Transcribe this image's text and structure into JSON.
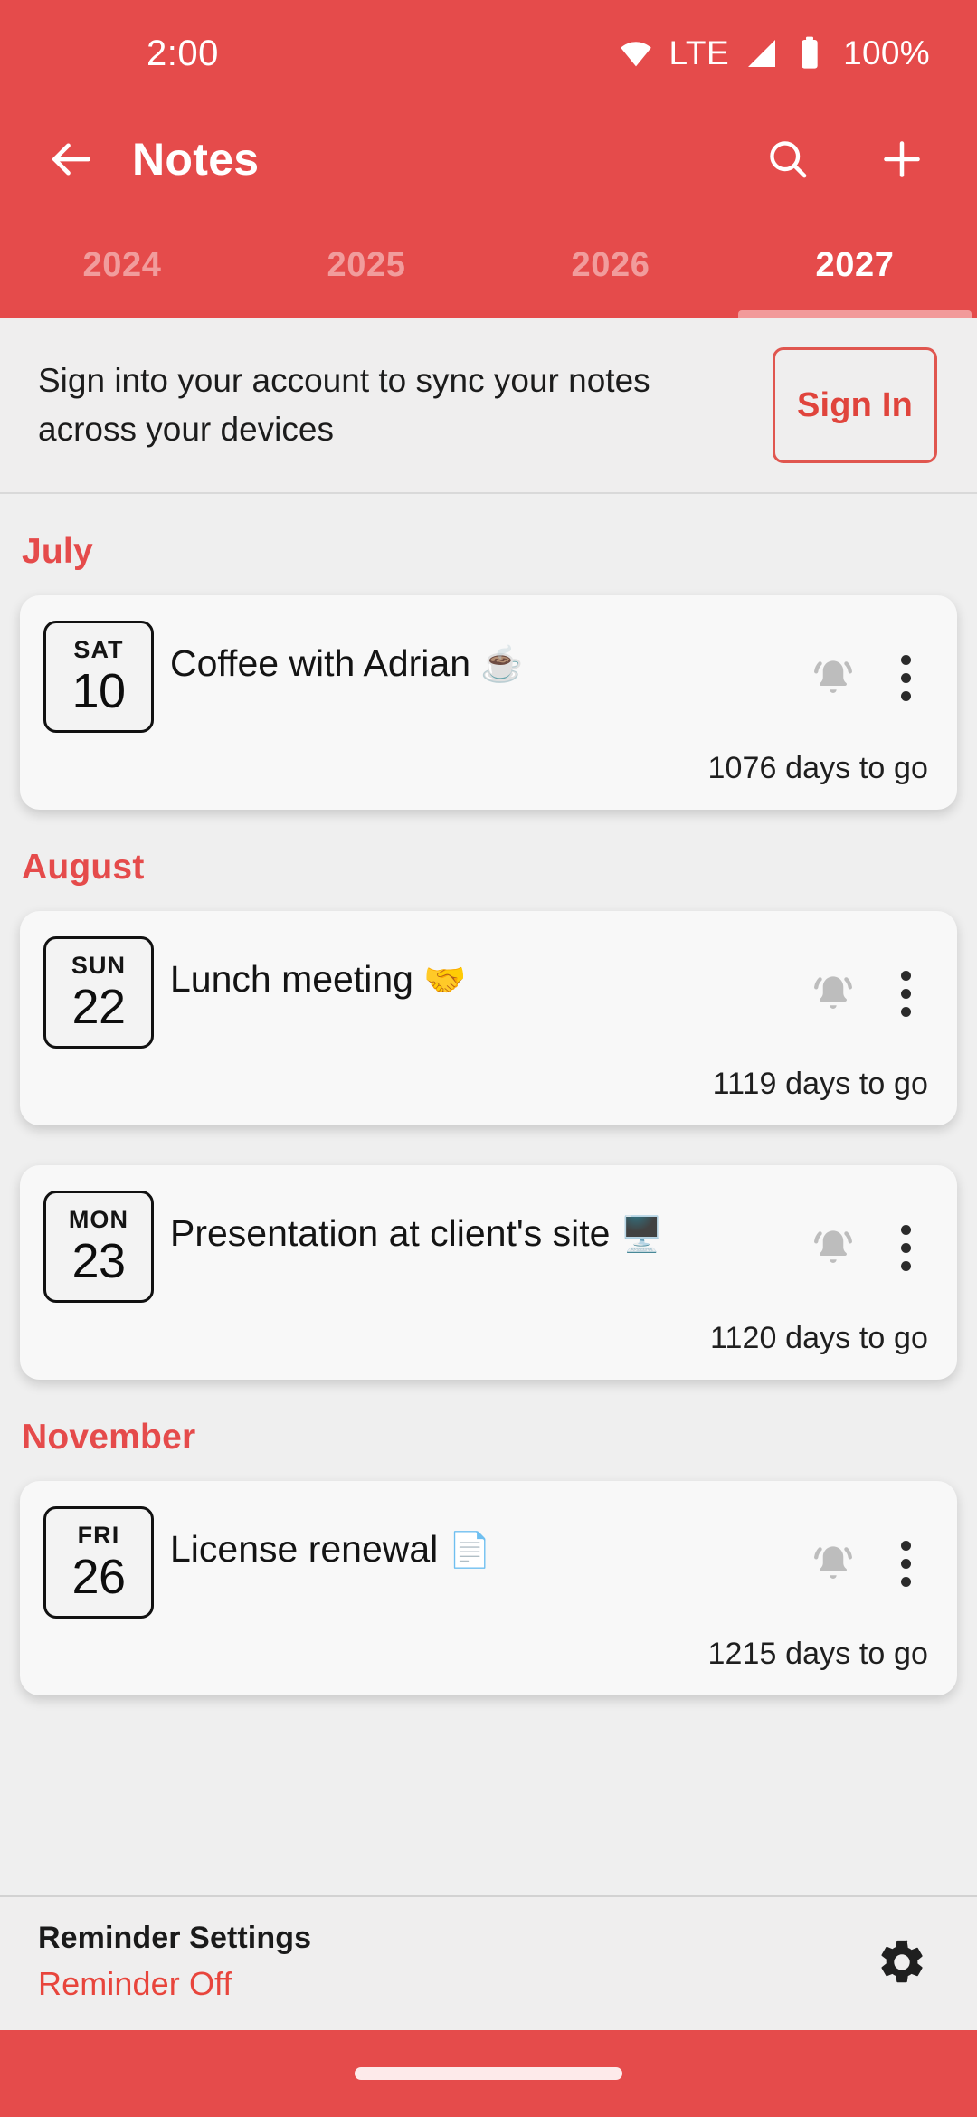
{
  "status_bar": {
    "time": "2:00",
    "network_label": "LTE",
    "battery_percent": "100%",
    "icons": [
      "wifi-icon",
      "signal-icon",
      "battery-icon"
    ]
  },
  "toolbar": {
    "back_icon": "back-arrow-icon",
    "title": "Notes",
    "search_icon": "search-icon",
    "add_icon": "plus-icon"
  },
  "tabs": [
    {
      "label": "2024",
      "active": false
    },
    {
      "label": "2025",
      "active": false
    },
    {
      "label": "2026",
      "active": false
    },
    {
      "label": "2027",
      "active": true
    }
  ],
  "signin_banner": {
    "message": "Sign into your account to sync your notes across your devices",
    "button_label": "Sign In"
  },
  "sections": [
    {
      "month": "July",
      "notes": [
        {
          "dow": "SAT",
          "day": "10",
          "title": "Coffee with Adrian",
          "emoji": "☕",
          "bell_icon": "bell-ringing-icon",
          "menu_icon": "more-vertical-icon",
          "countdown": "1076 days to go"
        }
      ]
    },
    {
      "month": "August",
      "notes": [
        {
          "dow": "SUN",
          "day": "22",
          "title": "Lunch meeting",
          "emoji": "🤝",
          "bell_icon": "bell-ringing-icon",
          "menu_icon": "more-vertical-icon",
          "countdown": "1119 days to go"
        },
        {
          "dow": "MON",
          "day": "23",
          "title": "Presentation at client's site",
          "emoji": "🖥️",
          "bell_icon": "bell-ringing-icon",
          "menu_icon": "more-vertical-icon",
          "countdown": "1120 days to go"
        }
      ]
    },
    {
      "month": "November",
      "notes": [
        {
          "dow": "FRI",
          "day": "26",
          "title": "License renewal",
          "emoji": "📄",
          "bell_icon": "bell-ringing-icon",
          "menu_icon": "more-vertical-icon",
          "countdown": "1215 days to go"
        }
      ]
    }
  ],
  "reminder_bar": {
    "title": "Reminder Settings",
    "status": "Reminder Off",
    "gear_icon": "gear-icon"
  },
  "colors": {
    "accent_red": "#e54b4b",
    "status_red": "#e8453c",
    "page_background": "#efefef",
    "card_background": "#f8f8f8",
    "tab_indicator": "#f29a9a"
  }
}
